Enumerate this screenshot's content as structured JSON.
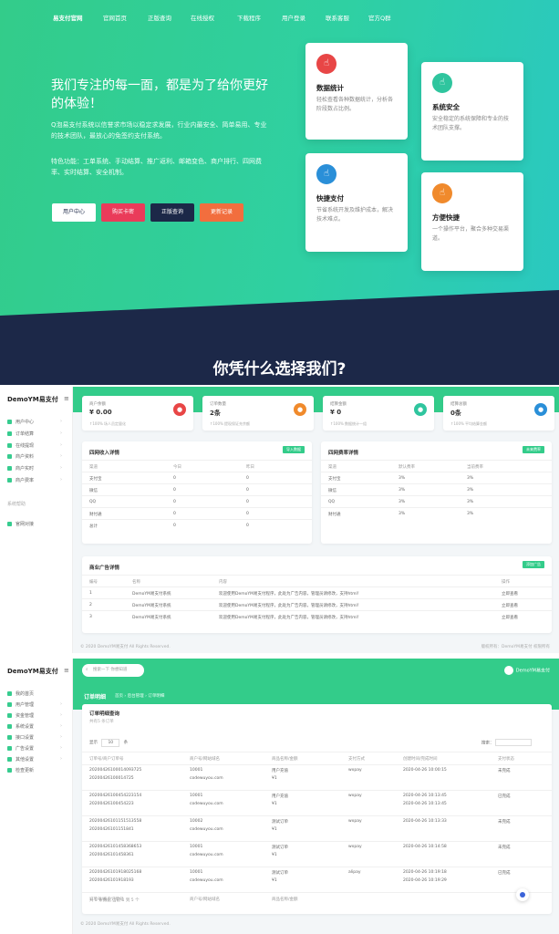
{
  "nav": [
    "易支付官网",
    "官网首页",
    "正版查询",
    "在线授权",
    "下载程序",
    "用户登录",
    "联系客服",
    "官方Q群"
  ],
  "hero": {
    "title": "我们专注的每一面，都是为了给你更好的体验！",
    "desc": "Q泡易支付系统以信誉求市场以稳定求发展，行业内最安全、简单易用、专业的技术团队，最放心的免签约支付系统。",
    "features": "特色功能：工单系统、手动结算、推广返利、邮箱变色、商户排行、四网费率、实时结算、安全机制。",
    "buttons": [
      "用户中心",
      "购买卡密",
      "正版查询",
      "更新记录"
    ]
  },
  "feature_cards": [
    {
      "title": "数据统计",
      "desc": "轻松查看各种数据统计，分析各阶段数占比例。",
      "color": "#e84646"
    },
    {
      "title": "系统安全",
      "desc": "安全稳定的系统保障和专业的技术团队支撑。",
      "color": "#2fc59e"
    },
    {
      "title": "快捷支付",
      "desc": "节省系统开发及维护成本，解决技术难点。",
      "color": "#2a8fd8"
    },
    {
      "title": "方便快捷",
      "desc": "一个操作平台，聚合多种交易渠道。",
      "color": "#f08a2c"
    }
  ],
  "why_title": "你凭什么选择我们?",
  "dash": {
    "brand": "DemoYM易支付",
    "menu": [
      "用户中心",
      "订单结算",
      "在线提现",
      "商户资料",
      "商户实时",
      "商户费率",
      "系统帮助",
      "官网对接"
    ],
    "stats": [
      {
        "label": "商户余额",
        "value": "¥ 0.00",
        "note": "↑100% 场人员定量化",
        "color": "#e84646"
      },
      {
        "label": "订单数量",
        "value": "2条",
        "note": "↑100% 提现保证充余额",
        "color": "#f08a2c"
      },
      {
        "label": "结算金额",
        "value": "¥ 0",
        "note": "↑100% 数据统计一组",
        "color": "#2fc59e"
      },
      {
        "label": "结算总额",
        "value": "0条",
        "note": "↑100% 平均结算金额",
        "color": "#2a8fd8"
      }
    ],
    "income_title": "四网收入详情",
    "income_btn": "导入数据",
    "income_cols": [
      "渠道",
      "今日",
      "昨日"
    ],
    "income_rows": [
      [
        "支付宝",
        "0",
        "0"
      ],
      [
        "微信",
        "0",
        "0"
      ],
      [
        "QQ",
        "0",
        "0"
      ],
      [
        "财付通",
        "0",
        "0"
      ],
      [
        "总计",
        "0",
        "0"
      ]
    ],
    "rate_title": "四网费率详情",
    "rate_btn": "未来费率",
    "rate_cols": [
      "渠道",
      "默认费率",
      "当前费率"
    ],
    "rate_rows": [
      [
        "支付宝",
        "3%",
        "3%"
      ],
      [
        "微信",
        "3%",
        "3%"
      ],
      [
        "QQ",
        "3%",
        "3%"
      ],
      [
        "财付通",
        "3%",
        "3%"
      ]
    ],
    "ad_title": "商业广告详情",
    "ad_btn": "添加广告",
    "ad_cols": [
      "编号",
      "名称",
      "内容",
      "操作"
    ],
    "ad_rows": [
      [
        "1",
        "DemoYM易支付系统",
        "欢迎使用DemoYM易支付程序，此处为广告内容，管理员请修改，支持html！",
        "立即查看"
      ],
      [
        "2",
        "DemoYM易支付系统",
        "欢迎使用DemoYM易支付程序，此处为广告内容，管理员请修改，支持html！",
        "立即查看"
      ],
      [
        "3",
        "DemoYM易支付系统",
        "欢迎使用DemoYM易支付程序，此处为广告内容，管理员请修改，支持html！",
        "立即查看"
      ]
    ],
    "footer": "© 2020 DemoYM易支付 All Rights Reserved.",
    "footer_right": "版权所有：DemoYM易支付 权限所有"
  },
  "orders": {
    "brand": "DemoYM易支付",
    "search_placeholder": "搜索一下 你想知道",
    "user": "DemoYM易支付",
    "menu": [
      "我的首页",
      "用户管理",
      "资金管理",
      "系统设置",
      "接口设置",
      "广告设置",
      "其他设置",
      "检查更新"
    ],
    "title": "订单明细",
    "crumbs": "首页 › 后台管理 › 订单明细",
    "panel_title": "订单明细查询",
    "panel_sub": "共有5 条订单",
    "show": "显示",
    "show_n": "10",
    "show_suffix": "条",
    "search_label": "搜索：",
    "cols": [
      "订单号/商户订单号",
      "商户号/网站域名",
      "商品名称/金额",
      "支付方式",
      "创建时间/完成时间",
      "支付状态"
    ],
    "rows": [
      [
        "20200426100014093725",
        "20200426100014725",
        "10001",
        "codewuyou.com",
        "用户充值",
        "¥1",
        "wxpay",
        "2020-04-26 10:00:15",
        "",
        "未完成"
      ],
      [
        "20200426100454223154",
        "20200426100454223",
        "10001",
        "codewuyou.com",
        "用户充值",
        "¥1",
        "wxpay",
        "2020-04-26 10:13:45",
        "2020-04-26 10:13:45",
        "已完成"
      ],
      [
        "20200426101151513558",
        "20200426101151841",
        "10002",
        "codewuyou.com",
        "测试订单",
        "¥1",
        "wxpay",
        "2020-04-26 10:13:33",
        "",
        "未完成"
      ],
      [
        "20200426101458368653",
        "20200426101458361",
        "10001",
        "codewuyou.com",
        "测试订单",
        "¥1",
        "wxpay",
        "2020-04-26 10:14:58",
        "",
        "未完成"
      ],
      [
        "20200426101918025168",
        "20200426101918193",
        "10001",
        "codewuyou.com",
        "测试订单",
        "¥1",
        "alipay",
        "2020-04-26 10:19:18",
        "2020-04-26 10:19:29",
        "已完成"
      ]
    ],
    "foot_cols": [
      "订单号/商户订单号",
      "商户号/网站域名",
      "商品名称/金额"
    ],
    "pager": "共 5 条数据 当前 1 到 5 个",
    "footer": "© 2020 DemoYM易支付 All Rights Reserved."
  }
}
